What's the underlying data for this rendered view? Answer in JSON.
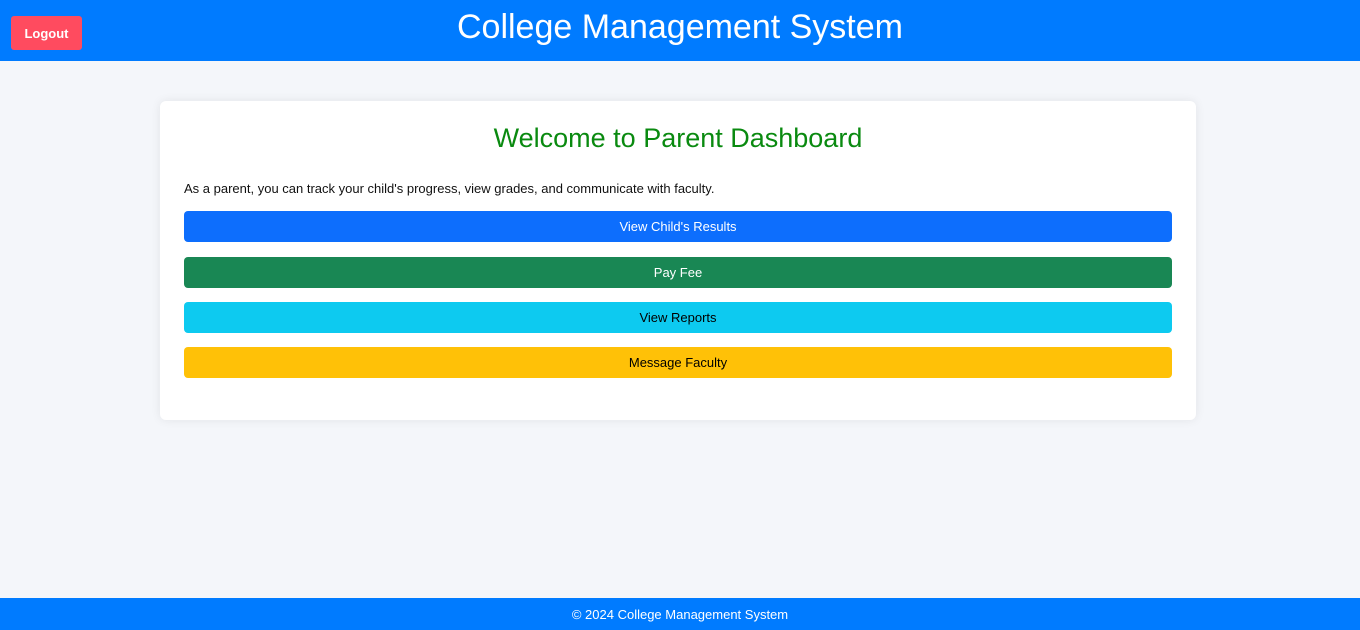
{
  "header": {
    "title": "College Management System",
    "logout_label": "Logout"
  },
  "card": {
    "title": "Welcome to Parent Dashboard",
    "description": "As a parent, you can track your child's progress, view grades, and communicate with faculty.",
    "buttons": [
      {
        "label": "View Child's Results",
        "color": "#0d6efd"
      },
      {
        "label": "Pay Fee",
        "color": "#198754"
      },
      {
        "label": "View Reports",
        "color": "#0dcaf0"
      },
      {
        "label": "Message Faculty",
        "color": "#ffc107"
      }
    ]
  },
  "footer": {
    "text": "© 2024 College Management System"
  },
  "colors": {
    "header_bg": "#007bff",
    "logout_bg": "#ff4b5f",
    "title_green": "#0a8a10",
    "page_bg": "#f4f6fa"
  }
}
